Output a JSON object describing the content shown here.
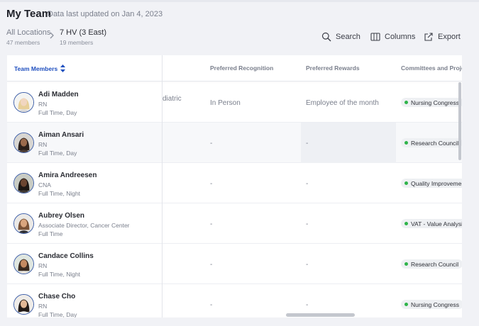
{
  "header": {
    "title": "My Team",
    "updated": "Data last updated on Jan 4, 2023"
  },
  "breadcrumb": [
    {
      "name": "All Locations",
      "count": "47 members"
    },
    {
      "name": "7 HV (3 East)",
      "count": "19 members"
    }
  ],
  "toolbar": {
    "search": "Search",
    "columns": "Columns",
    "export": "Export"
  },
  "table": {
    "headers": {
      "team": "Team Members",
      "recognition": "Preferred Recognition",
      "rewards": "Preferred Rewards",
      "committees": "Committees and Proje"
    },
    "rows": [
      {
        "name": "Adi Madden",
        "role": "RN",
        "schedule": "Full Time, Day",
        "partial": "diatric",
        "recognition": "In Person",
        "reward": "Employee of the month",
        "committee": "Nursing Congress"
      },
      {
        "name": "Aiman Ansari",
        "role": "RN",
        "schedule": "Full Time, Day",
        "partial": "",
        "recognition": "-",
        "reward": "-",
        "committee": "Research Council"
      },
      {
        "name": "Amira Andreesen",
        "role": "CNA",
        "schedule": "Full Time, Night",
        "partial": "",
        "recognition": "-",
        "reward": "-",
        "committee": "Quality Improvement"
      },
      {
        "name": "Aubrey Olsen",
        "role": "Associate Director, Cancer Center",
        "schedule": "Full Time",
        "partial": "",
        "recognition": "-",
        "reward": "-",
        "committee": "VAT - Value Analysis"
      },
      {
        "name": "Candace Collins",
        "role": "RN",
        "schedule": "Full Time, Night",
        "partial": "",
        "recognition": "-",
        "reward": "-",
        "committee": "Research Council"
      },
      {
        "name": "Chase Cho",
        "role": "RN",
        "schedule": "Full Time, Day",
        "partial": "",
        "recognition": "-",
        "reward": "-",
        "committee": "Nursing Congress"
      }
    ]
  },
  "colors": {
    "accent": "#1f4fbf",
    "status_dot": "#2fb44a",
    "avatar_ring": "#3e5fa8"
  },
  "icons": [
    "chevron-right-icon",
    "search-icon",
    "columns-icon",
    "export-icon",
    "sort-icon",
    "status-dot-icon"
  ]
}
